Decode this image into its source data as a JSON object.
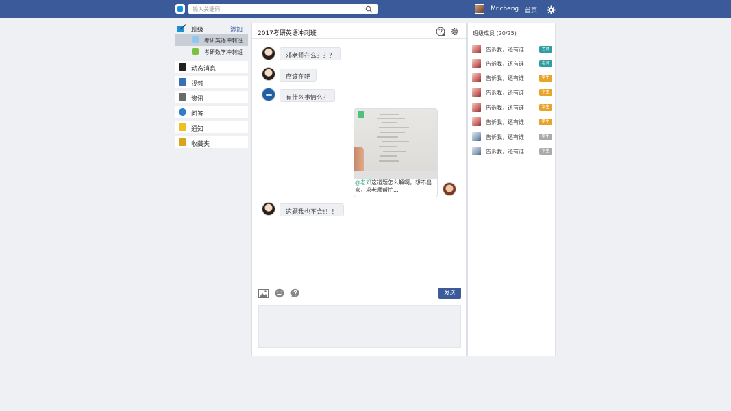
{
  "topbar": {
    "search_placeholder": "输入关键词",
    "username": "Mr.cheng",
    "home_label": "首页"
  },
  "sidebar": {
    "class_header": {
      "label": "班级",
      "add_label": "添加"
    },
    "classes": [
      {
        "label": "考研英语冲刺班",
        "active": true
      },
      {
        "label": "考研数学冲刺班",
        "active": false
      }
    ],
    "nav": [
      {
        "label": "动态消息",
        "icon": "chat-bubble-icon"
      },
      {
        "label": "视频",
        "icon": "video-icon"
      },
      {
        "label": "资讯",
        "icon": "news-icon"
      },
      {
        "label": "问答",
        "icon": "question-icon"
      },
      {
        "label": "通知",
        "icon": "megaphone-icon"
      },
      {
        "label": "收藏夹",
        "icon": "folder-icon"
      }
    ]
  },
  "chat": {
    "title": "2017考研英语冲刺班",
    "messages": [
      {
        "text": "邓老师在么？？？"
      },
      {
        "text": "应该在吧"
      },
      {
        "text": "有什么事情么？"
      },
      {
        "text": "这题我也不会!！！"
      }
    ],
    "card": {
      "mention": "@老邓",
      "text": "这道题怎么解啊，想不出来，求老师帮忙..."
    },
    "send_label": "发送"
  },
  "members": {
    "title": "班级成员 (20/25)",
    "list": [
      {
        "name": "告诉我，还有谁",
        "role": "老师",
        "color": "#2f9ea0"
      },
      {
        "name": "告诉我，还有谁",
        "role": "老师",
        "color": "#2f9ea0"
      },
      {
        "name": "告诉我，还有谁",
        "role": "学生",
        "color": "#e8a42a"
      },
      {
        "name": "告诉我，还有谁",
        "role": "学生",
        "color": "#e8a42a"
      },
      {
        "name": "告诉我，还有谁",
        "role": "学生",
        "color": "#e8a42a"
      },
      {
        "name": "告诉我，还有谁",
        "role": "学生",
        "color": "#e8a42a"
      },
      {
        "name": "告诉我，还有谁",
        "role": "学生",
        "color": "#aaaaaa"
      },
      {
        "name": "告诉我，还有谁",
        "role": "学生",
        "color": "#aaaaaa"
      }
    ]
  },
  "colors": {
    "brand": "#3b5a9a",
    "teacher_badge": "#2f9ea0",
    "student_badge": "#e8a42a",
    "offline_badge": "#aaaaaa"
  }
}
